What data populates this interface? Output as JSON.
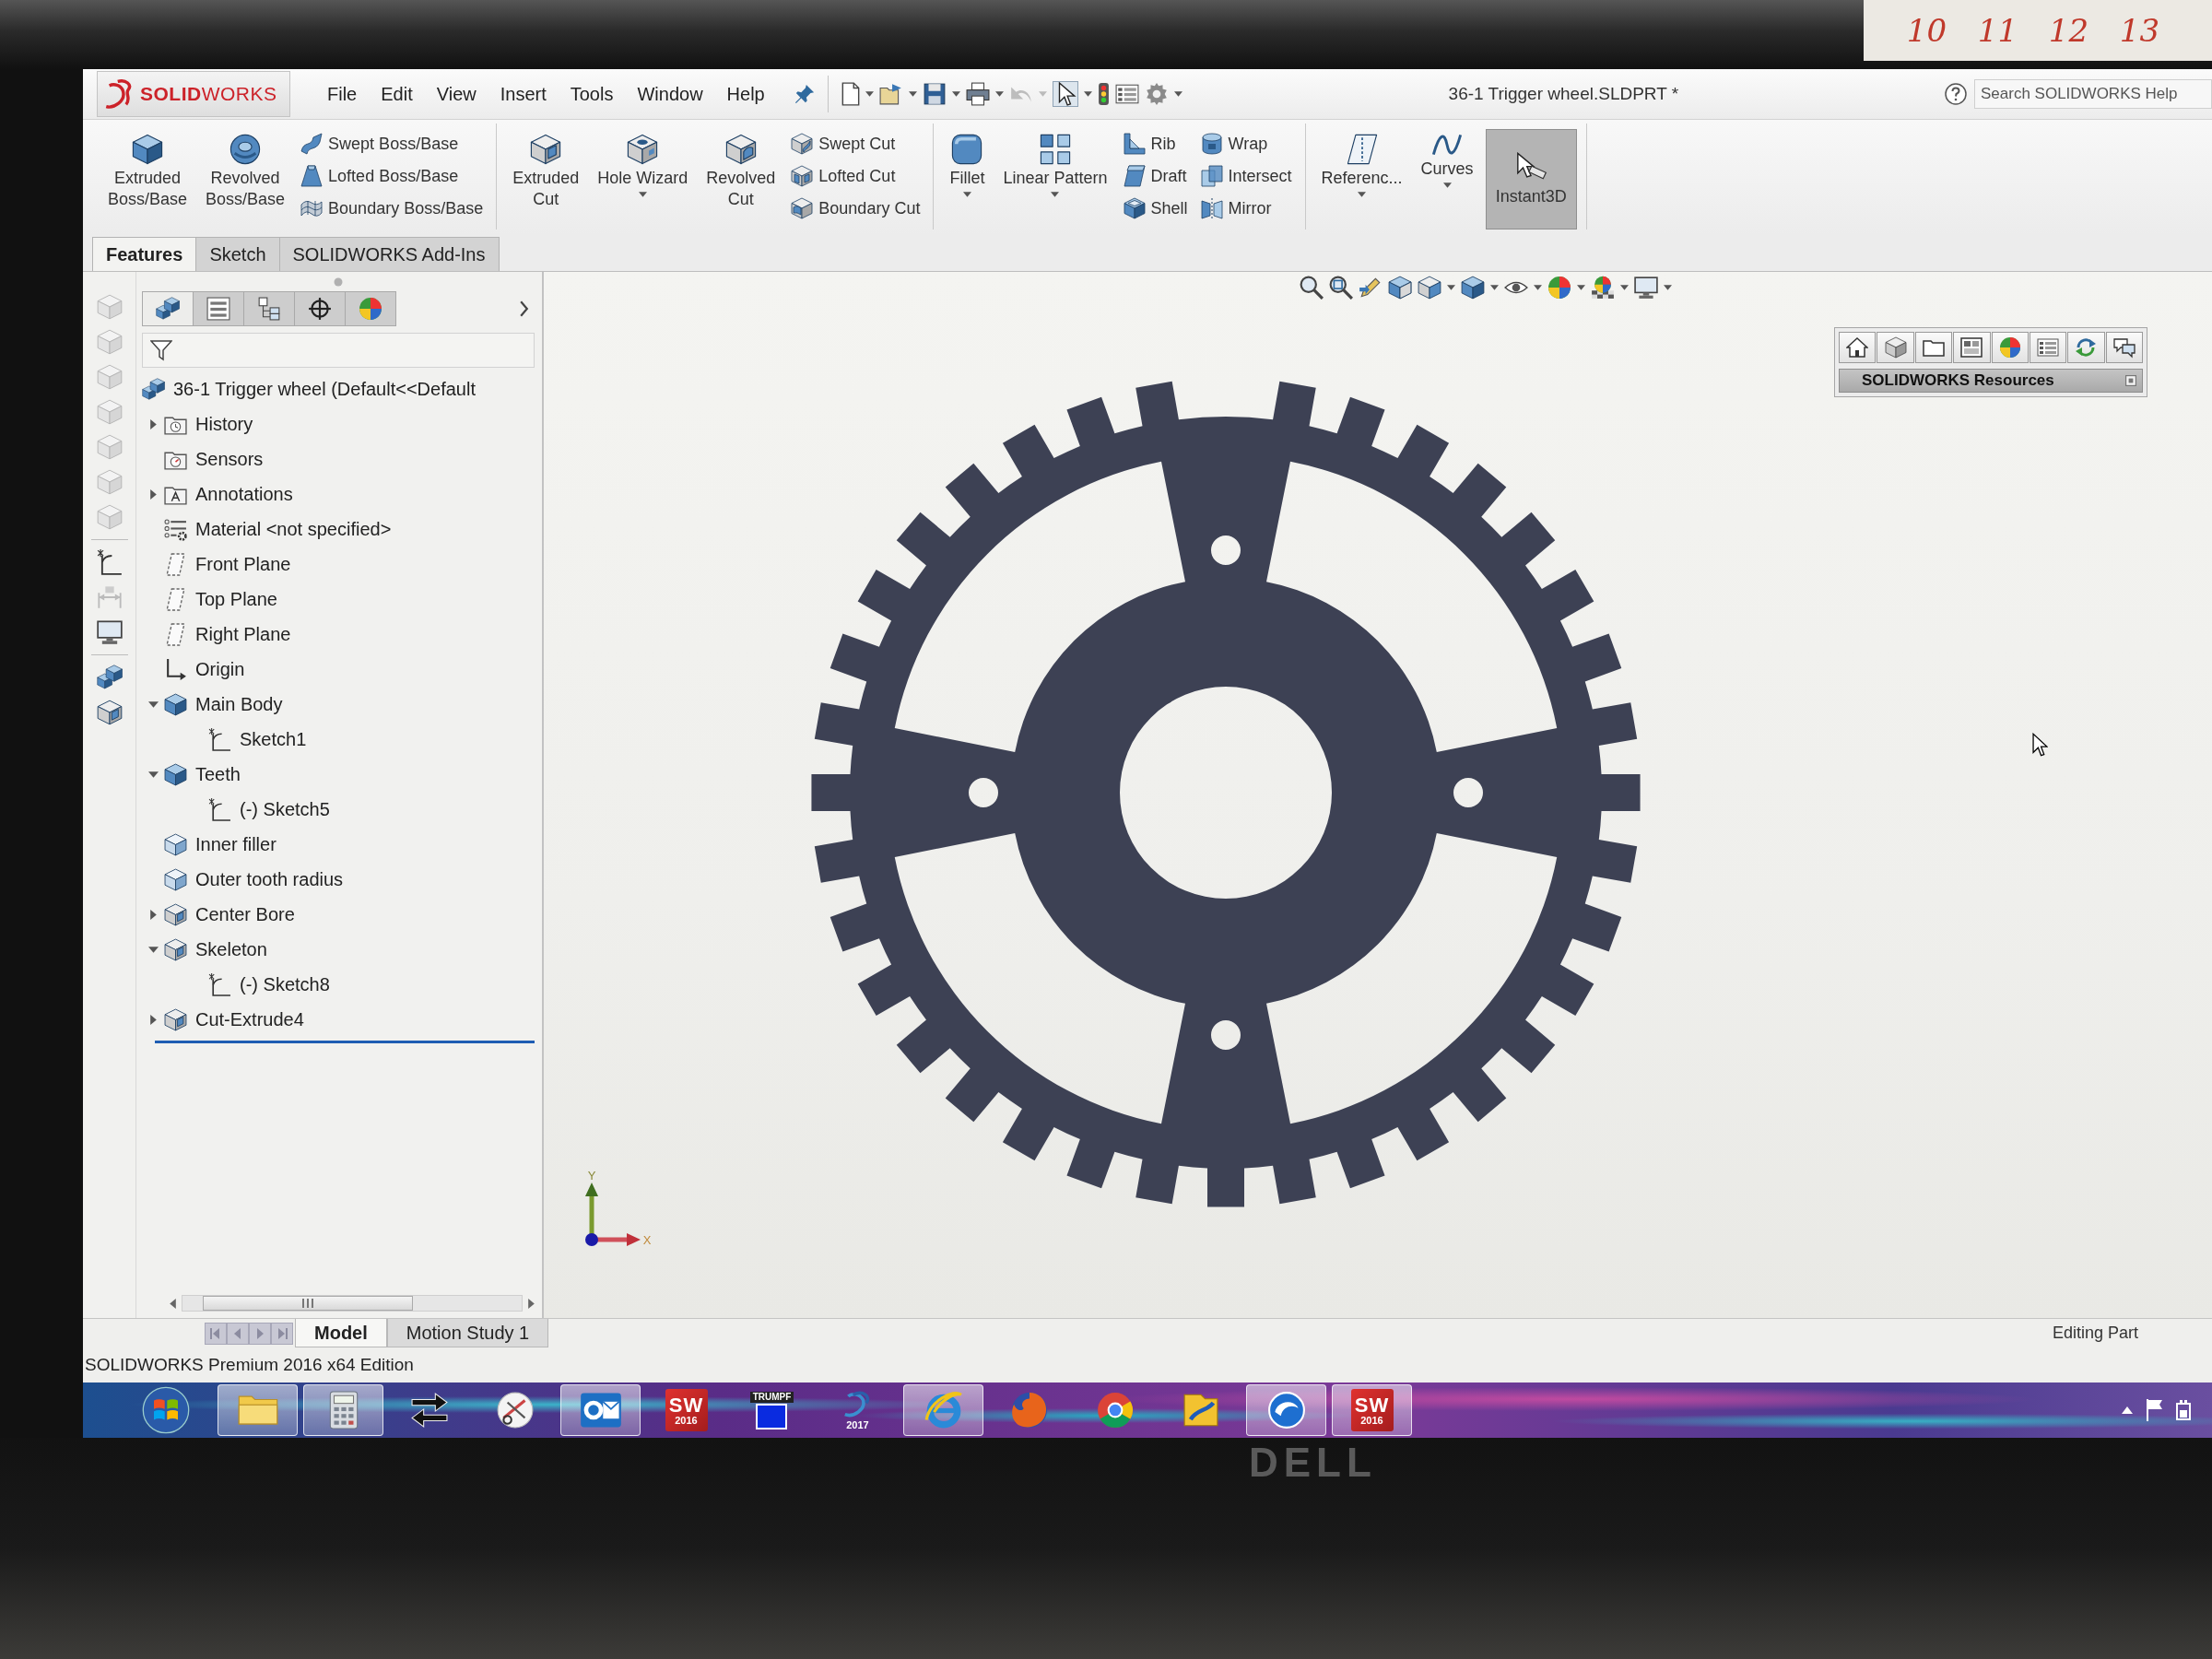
{
  "backdrop": {
    "calendar_days": [
      "10",
      "11",
      "12",
      "13"
    ]
  },
  "titlebar": {
    "logo": "**SOLID**WORKS",
    "menu": [
      "File",
      "Edit",
      "View",
      "Insert",
      "Tools",
      "Window",
      "Help"
    ],
    "document_title": "36-1 Trigger wheel.SLDPRT *",
    "search": {
      "placeholder": "Search SOLIDWORKS Help"
    }
  },
  "command_manager": {
    "groups": [
      {
        "tools": [
          {
            "kind": "stacked",
            "label": "Extruded Boss/Base"
          },
          {
            "kind": "stacked",
            "label": "Revolved Boss/Base"
          },
          {
            "kind": "column",
            "items": [
              "Swept Boss/Base",
              "Lofted Boss/Base",
              "Boundary Boss/Base"
            ]
          }
        ]
      },
      {
        "tools": [
          {
            "kind": "stacked",
            "label": "Extruded Cut"
          },
          {
            "kind": "menu",
            "label": "Hole Wizard"
          },
          {
            "kind": "stacked",
            "label": "Revolved Cut"
          },
          {
            "kind": "column",
            "items": [
              "Swept Cut",
              "Lofted Cut",
              "Boundary Cut"
            ]
          }
        ]
      },
      {
        "tools": [
          {
            "kind": "menu",
            "label": "Fillet"
          },
          {
            "kind": "menu",
            "label": "Linear Pattern"
          },
          {
            "kind": "column",
            "items": [
              "Rib",
              "Draft",
              "Shell"
            ]
          },
          {
            "kind": "column",
            "items": [
              "Wrap",
              "Intersect",
              "Mirror"
            ]
          }
        ]
      },
      {
        "tools": [
          {
            "kind": "menu",
            "label": "Referenc..."
          },
          {
            "kind": "menu",
            "label": "Curves"
          },
          {
            "kind": "toggle",
            "label": "Instant3D",
            "selected": true
          }
        ]
      }
    ],
    "tabs": [
      {
        "label": "Features",
        "selected": true
      },
      {
        "label": "Sketch",
        "selected": false
      },
      {
        "label": "SOLIDWORKS Add-Ins",
        "selected": false
      }
    ]
  },
  "feature_manager": {
    "tabs": [
      {
        "selected": true
      },
      {
        "selected": false
      },
      {
        "selected": false
      },
      {
        "selected": false
      },
      {
        "selected": false
      }
    ],
    "tree": [
      {
        "label": "36-1 Trigger wheel (Default<<Default",
        "kind": "part",
        "children": [
          {
            "label": "History",
            "kind": "history",
            "expanded": false
          },
          {
            "label": "Sensors",
            "kind": "sensors"
          },
          {
            "label": "Annotations",
            "kind": "annotations",
            "expanded": false
          },
          {
            "label": "Material <not specified>",
            "kind": "material"
          },
          {
            "label": "Front Plane",
            "kind": "plane"
          },
          {
            "label": "Top Plane",
            "kind": "plane"
          },
          {
            "label": "Right Plane",
            "kind": "plane"
          },
          {
            "label": "Origin",
            "kind": "origin"
          },
          {
            "label": "Main Body",
            "kind": "boss",
            "expanded": true,
            "children": [
              {
                "label": "Sketch1",
                "kind": "sketch"
              }
            ]
          },
          {
            "label": "Teeth",
            "kind": "boss",
            "expanded": true,
            "children": [
              {
                "label": "(-) Sketch5",
                "kind": "sketch"
              }
            ]
          },
          {
            "label": "Inner filler",
            "kind": "body"
          },
          {
            "label": "Outer tooth radius",
            "kind": "body"
          },
          {
            "label": "Center Bore",
            "kind": "cut",
            "expanded": false
          },
          {
            "label": "Skeleton",
            "kind": "cut",
            "expanded": true,
            "children": [
              {
                "label": "(-) Sketch8",
                "kind": "sketch"
              }
            ]
          },
          {
            "label": "Cut-Extrude4",
            "kind": "cut",
            "expanded": false
          }
        ]
      }
    ]
  },
  "task_pane": {
    "title": "SOLIDWORKS Resources"
  },
  "triad": {
    "x_label": "X",
    "y_label": "Y"
  },
  "bottom_tabs": [
    {
      "label": "Model",
      "selected": true
    },
    {
      "label": "Motion Study 1",
      "selected": false
    }
  ],
  "status_bar": {
    "product": "SOLIDWORKS Premium 2016 x64 Edition",
    "mode": "Editing Part"
  },
  "taskbar": {
    "apps": [
      {
        "kind": "explorer",
        "running": true
      },
      {
        "kind": "calculator",
        "running": true
      },
      {
        "kind": "switcher",
        "running": false
      },
      {
        "kind": "snipping",
        "running": false
      },
      {
        "kind": "outlook",
        "running": true
      },
      {
        "kind": "solidworks",
        "running": false,
        "mark": "SW",
        "version": "2016"
      },
      {
        "kind": "trumpf",
        "running": false,
        "label": "TRUMPF"
      },
      {
        "kind": "ds",
        "running": false,
        "version": "2017"
      },
      {
        "kind": "ie",
        "running": true
      },
      {
        "kind": "firefox",
        "running": false
      },
      {
        "kind": "chrome",
        "running": false
      },
      {
        "kind": "folder_app",
        "running": false
      },
      {
        "kind": "remote",
        "running": true
      },
      {
        "kind": "solidworks",
        "running": true,
        "mark": "SW",
        "version": "2016"
      }
    ]
  },
  "monitor": {
    "logo": "DELL"
  }
}
